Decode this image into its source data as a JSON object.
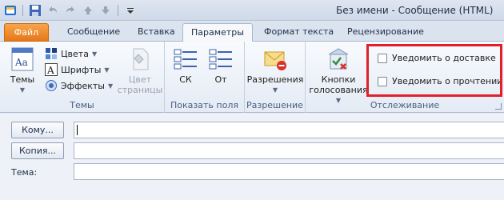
{
  "window": {
    "title": "Без имени  -  Сообщение (HTML)"
  },
  "quick_access": [
    "save-icon",
    "undo-icon",
    "redo-icon",
    "up-arrow-icon",
    "down-arrow-icon",
    "customize-icon"
  ],
  "tabs": [
    {
      "label": "Файл",
      "state": "file"
    },
    {
      "label": "Сообщение",
      "state": "normal"
    },
    {
      "label": "Вставка",
      "state": "normal"
    },
    {
      "label": "Параметры",
      "state": "active"
    },
    {
      "label": "Формат текста",
      "state": "normal"
    },
    {
      "label": "Рецензирование",
      "state": "normal"
    }
  ],
  "ribbon": {
    "themes": {
      "group_label": "Темы",
      "themes_button": "Темы",
      "colors": "Цвета",
      "fonts": "Шрифты",
      "effects": "Эффекты",
      "page_color_line1": "Цвет",
      "page_color_line2": "страницы"
    },
    "show_fields": {
      "group_label": "Показать поля",
      "bcc": "СК",
      "from": "От"
    },
    "permission": {
      "group_label": "Разрешение",
      "permissions": "Разрешения"
    },
    "tracking": {
      "group_label": "Отслеживание",
      "voting_line1": "Кнопки",
      "voting_line2": "голосования",
      "delivery_receipt": "Уведомить о доставке",
      "read_receipt": "Уведомить о прочтении"
    }
  },
  "form": {
    "to_button": "Кому...",
    "cc_button": "Копия...",
    "subject_label": "Тема:"
  },
  "colors": {
    "file_tab": "#e57718",
    "highlight": "#e0202a"
  }
}
